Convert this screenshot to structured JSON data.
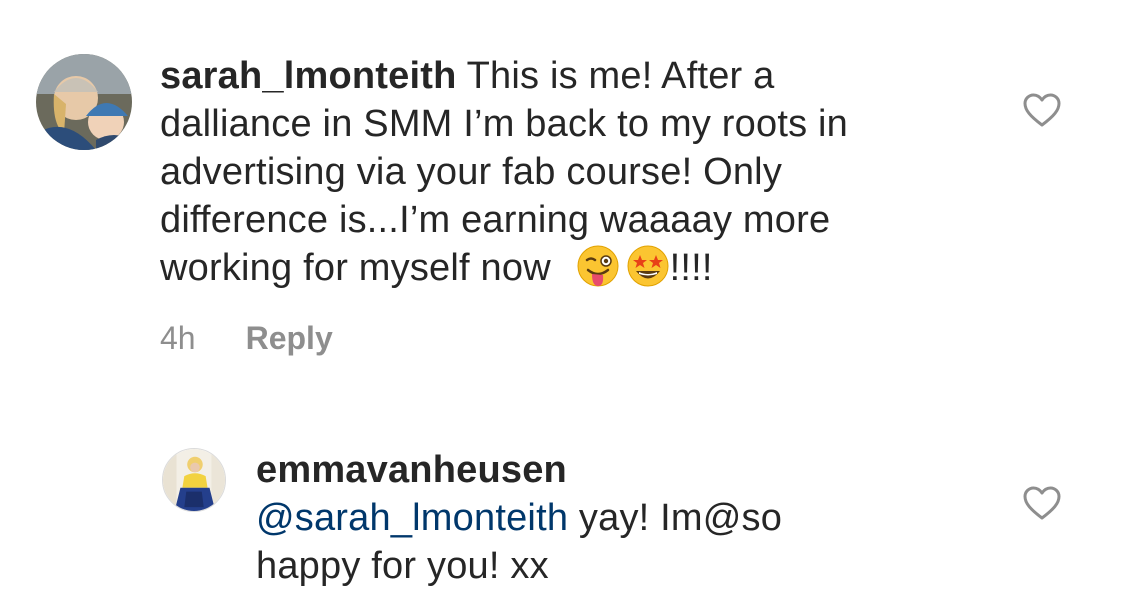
{
  "comments": [
    {
      "username": "sarah_lmonteith",
      "body_line1": "This is me! After a",
      "body_line2": "dalliance in SMM I’m back to my roots in",
      "body_line3": "advertising via your fab course! Only",
      "body_line4": "difference is...I’m earning waaaay more",
      "body_line5": "working for myself now",
      "body_suffix": "!!!!",
      "emojis": [
        "winking-face-with-tongue",
        "star-struck"
      ],
      "time": "4h",
      "reply_label": "Reply"
    },
    {
      "username": "emmavanheusen",
      "mention": "@sarah_lmonteith",
      "body_line1": " yay! Im@so",
      "body_line2": "happy for you! xx"
    }
  ],
  "colors": {
    "text": "#262626",
    "secondary": "#8e8e8e",
    "mention": "#00376b"
  }
}
